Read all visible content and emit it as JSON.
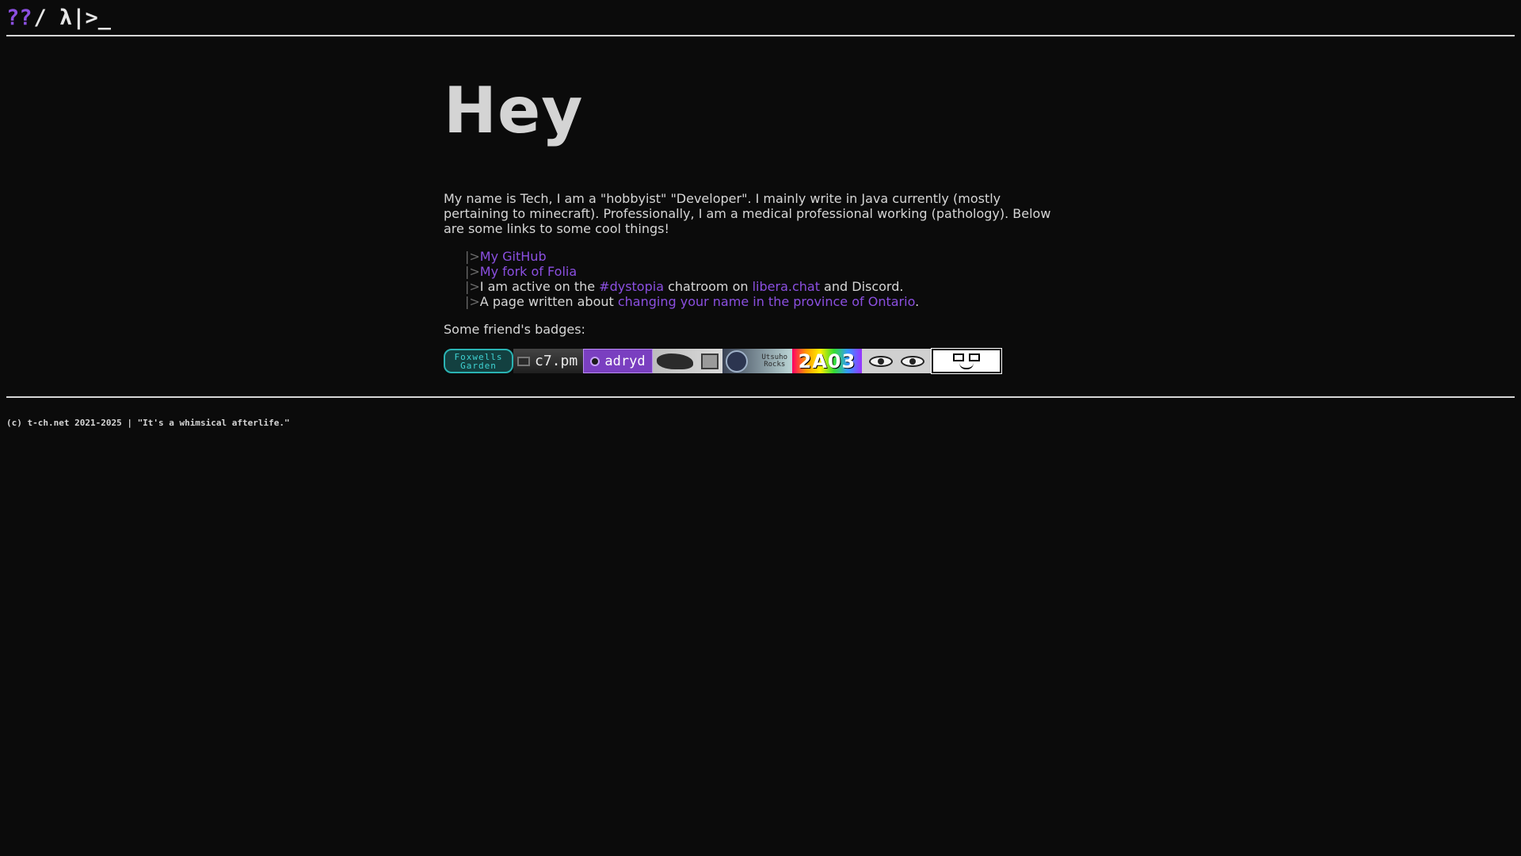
{
  "header": {
    "logo_prefix": "??",
    "logo_rest": "/ λ|>_"
  },
  "hero": {
    "title": "Hey"
  },
  "intro": {
    "text": "My name is Tech, I am a \"hobbyist\" \"Developer\". I mainly write in Java currently (mostly pertaining to minecraft). Professionally, I am a medical professional working (pathology). Below are some links to some cool things!"
  },
  "links": {
    "marker": "|>",
    "github": "My GitHub",
    "folia": "My fork of Folia",
    "active_prefix": "I am active on the ",
    "dystopia": "#dystopia",
    "active_mid": " chatroom on ",
    "libera": "libera.chat",
    "active_suffix": " and Discord.",
    "page_prefix": "A page written about ",
    "ontario": "changing your name in the province of Ontario",
    "page_suffix": "."
  },
  "badges": {
    "label": "Some friend's badges:",
    "b1_line1": "Foxwells",
    "b1_line2": "Garden",
    "b2": "c7.pm",
    "b3": "adryd",
    "b5_line1": "Utsuho",
    "b5_line2": "Rocks",
    "b6": "2A03"
  },
  "footer": {
    "text": "(c) t-ch.net 2021-2025 | \"It's a whimsical afterlife.\""
  },
  "colors": {
    "background": "#0b0b0b",
    "text": "#d6d6d6",
    "link": "#8b4fe0",
    "marker": "#6a6a6a"
  }
}
